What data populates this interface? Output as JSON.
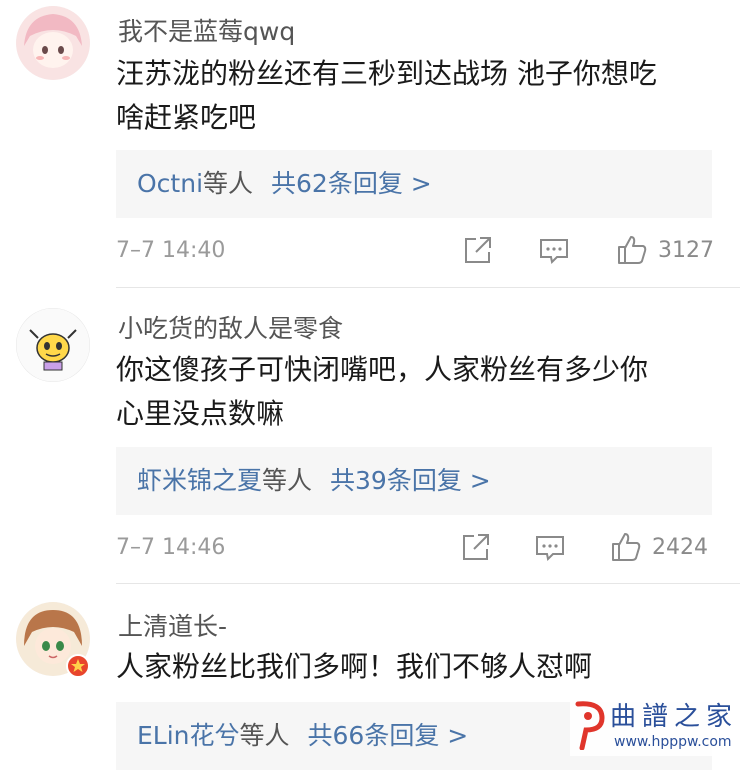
{
  "comments": [
    {
      "username": "我不是蓝莓qwq",
      "text_lines": [
        "汪苏泷的粉丝还有三秒到达战场 池子你想吃",
        "啥赶紧吃吧"
      ],
      "reply": {
        "names": "Octni",
        "suffix": "等人",
        "count": "共62条回复 >"
      },
      "time": "7–7 14:40",
      "likes": "3127"
    },
    {
      "username": "小吃货的敌人是零食",
      "text_lines": [
        "你这傻孩子可快闭嘴吧，人家粉丝有多少你",
        "心里没点数嘛"
      ],
      "reply": {
        "names": "虾米锦之夏",
        "suffix": "等人",
        "count": "共39条回复 >"
      },
      "time": "7–7 14:46",
      "likes": "2424"
    },
    {
      "username": "上清道长-",
      "text_lines": [
        "人家粉丝比我们多啊！我们不够人怼啊"
      ],
      "reply": {
        "names": "ELin花兮",
        "suffix": "等人",
        "count": "共66条回复 >"
      }
    }
  ],
  "watermark": {
    "title": "曲譜之家",
    "url": "www.hpppw.com"
  },
  "colors": {
    "link": "#4a74a8",
    "reply_bg": "#f6f6f6",
    "meta": "#9a9a9a"
  }
}
